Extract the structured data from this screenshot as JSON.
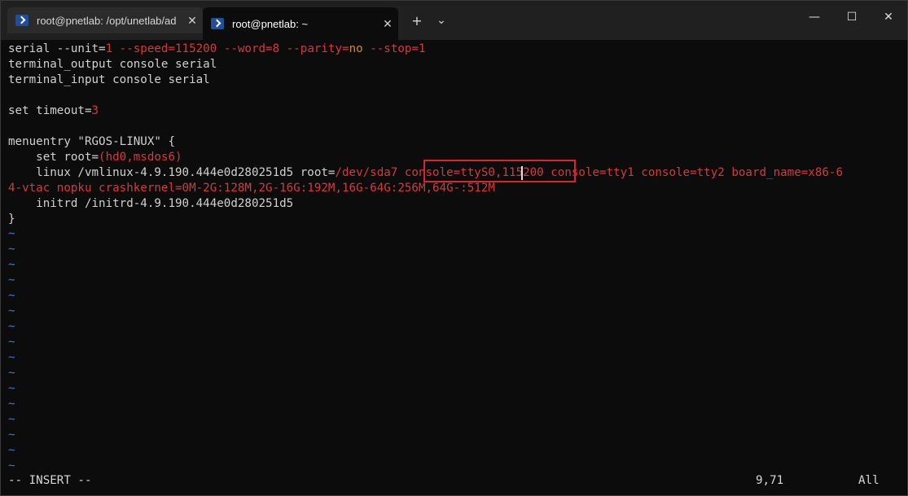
{
  "tabs": [
    {
      "title": "root@pnetlab: /opt/unetlab/ad",
      "close": "✕",
      "active": false
    },
    {
      "title": "root@pnetlab: ~",
      "close": "✕",
      "active": true
    }
  ],
  "toolbar": {
    "new_tab": "+",
    "dropdown": "⌄"
  },
  "window_controls": {
    "minimize": "—",
    "maximize": "☐",
    "close": "✕"
  },
  "lines": {
    "l1a": "serial --unit=",
    "l1b": "1",
    "l1c": " --speed=",
    "l1d": "115200",
    "l1e": " --word=",
    "l1f": "8",
    "l1g": " --parity=",
    "l1h": "no",
    "l1i": " --stop=",
    "l1j": "1",
    "l2": "terminal_output console serial",
    "l3": "terminal_input console serial",
    "l5a": "set timeout=",
    "l5b": "3",
    "l7": "menuentry \"RGOS-LINUX\" {",
    "l8a": "    set root=",
    "l8b": "(hd0,msdos6)",
    "l9a": "    linux /vmlinux-4.9.190.444e0d280251d5 root=",
    "l9b": "/dev/sda7 console=ttyS0,115200 console=tty1 console=tty2 board_name=x86-6",
    "l10": "4-vtac nopku crashkernel=0M-2G:128M,2G-16G:192M,16G-64G:256M,64G-:512M",
    "l11": "    initrd /initrd-4.9.190.444e0d280251d5",
    "l12": "}"
  },
  "tilde": "~",
  "status": {
    "mode": "-- INSERT --",
    "position": "9,71",
    "scroll": "All"
  }
}
